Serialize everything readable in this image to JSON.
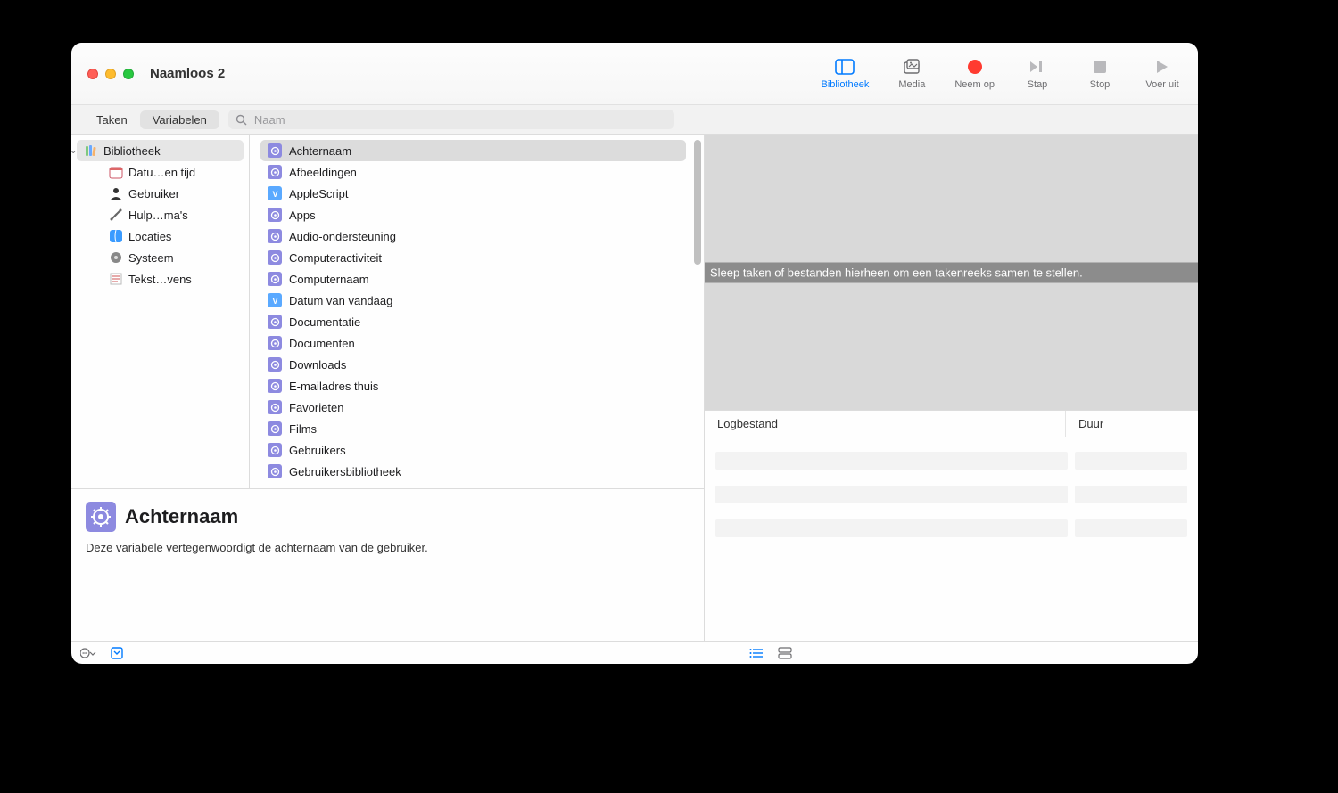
{
  "window": {
    "title": "Naamloos 2"
  },
  "toolbar": {
    "library": "Bibliotheek",
    "media": "Media",
    "record": "Neem op",
    "step": "Stap",
    "stop": "Stop",
    "run": "Voer uit"
  },
  "tabs": {
    "tasks": "Taken",
    "variables": "Variabelen"
  },
  "search": {
    "placeholder": "Naam"
  },
  "categories": {
    "root": "Bibliotheek",
    "items": [
      "Datu…en tijd",
      "Gebruiker",
      "Hulp…ma's",
      "Locaties",
      "Systeem",
      "Tekst…vens"
    ]
  },
  "variables": [
    {
      "label": "Achternaam",
      "type": "gear",
      "selected": true
    },
    {
      "label": "Afbeeldingen",
      "type": "gear"
    },
    {
      "label": "AppleScript",
      "type": "v"
    },
    {
      "label": "Apps",
      "type": "gear"
    },
    {
      "label": "Audio-ondersteuning",
      "type": "gear"
    },
    {
      "label": "Computeractiviteit",
      "type": "gear"
    },
    {
      "label": "Computernaam",
      "type": "gear"
    },
    {
      "label": "Datum van vandaag",
      "type": "v"
    },
    {
      "label": "Documentatie",
      "type": "gear"
    },
    {
      "label": "Documenten",
      "type": "gear"
    },
    {
      "label": "Downloads",
      "type": "gear"
    },
    {
      "label": "E-mailadres thuis",
      "type": "gear"
    },
    {
      "label": "Favorieten",
      "type": "gear"
    },
    {
      "label": "Films",
      "type": "gear"
    },
    {
      "label": "Gebruikers",
      "type": "gear"
    },
    {
      "label": "Gebruikersbibliotheek",
      "type": "gear"
    }
  ],
  "description": {
    "title": "Achternaam",
    "body": "Deze variabele vertegenwoordigt de achternaam van de gebruiker."
  },
  "canvas": {
    "drop_hint": "Sleep taken of bestanden hierheen om een takenreeks samen te stellen."
  },
  "log": {
    "col1": "Logbestand",
    "col2": "Duur"
  }
}
